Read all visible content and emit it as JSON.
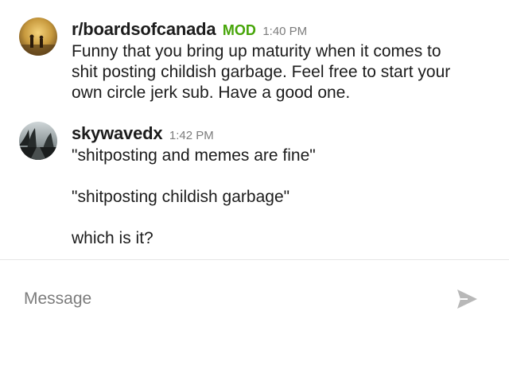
{
  "messages": [
    {
      "username": "r/boardsofcanada",
      "badge": "MOD",
      "time": "1:40 PM",
      "lines": [
        "Funny that you bring up maturity when it comes to",
        "shit posting childish garbage. Feel free to start your",
        "own circle jerk sub. Have a good one."
      ]
    },
    {
      "username": "skywavedx",
      "time": "1:42 PM",
      "paragraphs": [
        "\"shitposting and memes are fine\"",
        "\"shitposting childish garbage\"",
        "which is it?"
      ]
    }
  ],
  "composer": {
    "placeholder": "Message",
    "send_icon": "send-arrow-icon"
  },
  "colors": {
    "mod_badge": "#46a508",
    "timestamp": "#7c7c7c",
    "send_icon": "#b8b8b8",
    "divider": "#e5e5e5"
  }
}
